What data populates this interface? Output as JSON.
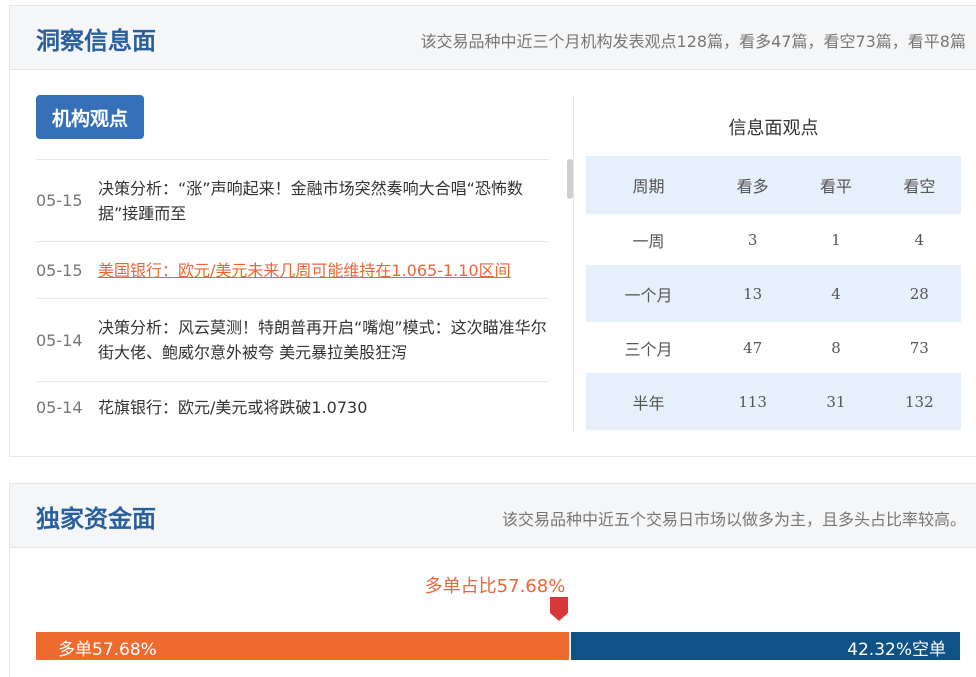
{
  "info_section": {
    "title": "洞察信息面",
    "summary": "该交易品种中近三个月机构发表观点128篇，看多47篇，看空73篇，看平8篇",
    "tag_button": "机构观点",
    "news": [
      {
        "date": "05-15",
        "text": "决策分析：“涨”声响起来！金融市场突然奏响大合唱“恐怖数据”接踵而至",
        "highlight": false
      },
      {
        "date": "05-15",
        "text": "美国银行：欧元/美元未来几周可能维持在1.065-1.10区间",
        "highlight": true
      },
      {
        "date": "05-14",
        "text": "决策分析：风云莫测！特朗普再开启“嘴炮”模式：这次瞄准华尔街大佬、鲍威尔意外被夸 美元暴拉美股狂泻",
        "highlight": false
      },
      {
        "date": "05-14",
        "text": "花旗银行：欧元/美元或将跌破1.0730",
        "highlight": false
      }
    ],
    "stats": {
      "title": "信息面观点",
      "headers": [
        "周期",
        "看多",
        "看平",
        "看空"
      ],
      "rows": [
        {
          "period": "一周",
          "bull": "3",
          "neutral": "1",
          "bear": "4"
        },
        {
          "period": "一个月",
          "bull": "13",
          "neutral": "4",
          "bear": "28"
        },
        {
          "period": "三个月",
          "bull": "47",
          "neutral": "8",
          "bear": "73"
        },
        {
          "period": "半年",
          "bull": "113",
          "neutral": "31",
          "bear": "132"
        }
      ]
    }
  },
  "fund_section": {
    "title": "独家资金面",
    "summary": "该交易品种中近五个交易日市场以做多为主，且多头占比率较高。",
    "ratio_label": "多单占比57.68%",
    "long_label": "多单57.68%",
    "short_label": "42.32%空单",
    "long_percent": 57.68,
    "short_percent": 42.32,
    "colors": {
      "long": "#ee6a2f",
      "short": "#0f5286",
      "marker": "#d9383a"
    }
  }
}
